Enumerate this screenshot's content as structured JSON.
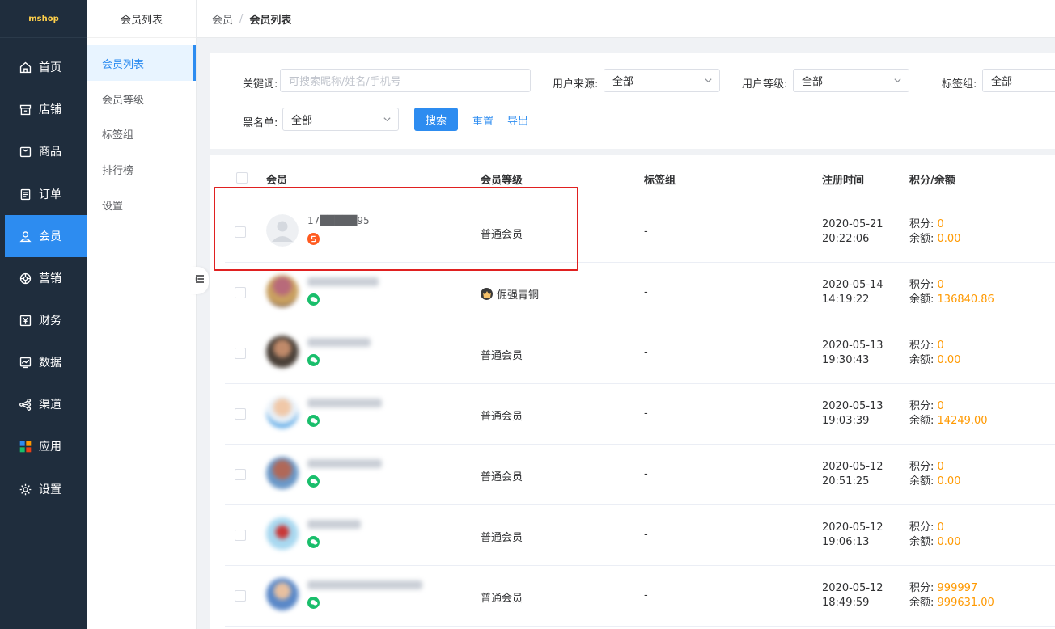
{
  "app": {
    "logo": "mshop"
  },
  "nav": {
    "items": [
      {
        "label": "首页",
        "icon": "home-icon"
      },
      {
        "label": "店铺",
        "icon": "store-icon"
      },
      {
        "label": "商品",
        "icon": "bag-icon"
      },
      {
        "label": "订单",
        "icon": "order-icon"
      },
      {
        "label": "会员",
        "icon": "user-icon",
        "active": true
      },
      {
        "label": "营销",
        "icon": "marketing-icon"
      },
      {
        "label": "财务",
        "icon": "yen-icon"
      },
      {
        "label": "数据",
        "icon": "chart-icon"
      },
      {
        "label": "渠道",
        "icon": "share-icon"
      },
      {
        "label": "应用",
        "icon": "apps-icon"
      },
      {
        "label": "设置",
        "icon": "gear-icon"
      }
    ]
  },
  "submenu": {
    "title": "会员列表",
    "items": [
      {
        "label": "会员列表",
        "active": true
      },
      {
        "label": "会员等级"
      },
      {
        "label": "标签组"
      },
      {
        "label": "排行榜"
      },
      {
        "label": "设置"
      }
    ]
  },
  "breadcrumb": {
    "root": "会员",
    "separator": "/",
    "current": "会员列表"
  },
  "filter": {
    "keyword_label": "关键词:",
    "keyword_placeholder": "可搜索昵称/姓名/手机号",
    "source_label": "用户来源:",
    "source_value": "全部",
    "level_label": "用户等级:",
    "level_value": "全部",
    "tag_label": "标签组:",
    "tag_value": "全部",
    "blacklist_label": "黑名单:",
    "blacklist_value": "全部",
    "search_button": "搜索",
    "reset_link": "重置",
    "export_link": "导出"
  },
  "table": {
    "headers": {
      "member": "会员",
      "level": "会员等级",
      "tag": "标签组",
      "reg_time": "注册时间",
      "points_balance": "积分/余额"
    },
    "points_label": "积分:",
    "balance_label": "余额:",
    "rows": [
      {
        "nickname": "17█████95",
        "source": "h5",
        "level": "普通会员",
        "tag": "-",
        "date": "2020-05-21",
        "time": "20:22:06",
        "points": "0",
        "balance": "0.00"
      },
      {
        "nickname": "",
        "source": "wechat",
        "level": "倔强青铜",
        "tag": "-",
        "date": "2020-05-14",
        "time": "14:19:22",
        "points": "0",
        "balance": "136840.86"
      },
      {
        "nickname": "",
        "source": "wechat",
        "level": "普通会员",
        "tag": "-",
        "date": "2020-05-13",
        "time": "19:30:43",
        "points": "0",
        "balance": "0.00"
      },
      {
        "nickname": "",
        "source": "wechat",
        "level": "普通会员",
        "tag": "-",
        "date": "2020-05-13",
        "time": "19:03:39",
        "points": "0",
        "balance": "14249.00"
      },
      {
        "nickname": "",
        "source": "wechat",
        "level": "普通会员",
        "tag": "-",
        "date": "2020-05-12",
        "time": "20:51:25",
        "points": "0",
        "balance": "0.00"
      },
      {
        "nickname": "",
        "source": "wechat",
        "level": "普通会员",
        "tag": "-",
        "date": "2020-05-12",
        "time": "19:06:13",
        "points": "0",
        "balance": "0.00"
      },
      {
        "nickname": "",
        "source": "wechat",
        "level": "普通会员",
        "tag": "-",
        "date": "2020-05-12",
        "time": "18:49:59",
        "points": "999997",
        "balance": "999631.00"
      }
    ]
  },
  "colors": {
    "sidebar": "#1f2d3d",
    "accent": "#2d8cf0",
    "amount": "#ff9900",
    "highlight": "#e02020"
  }
}
